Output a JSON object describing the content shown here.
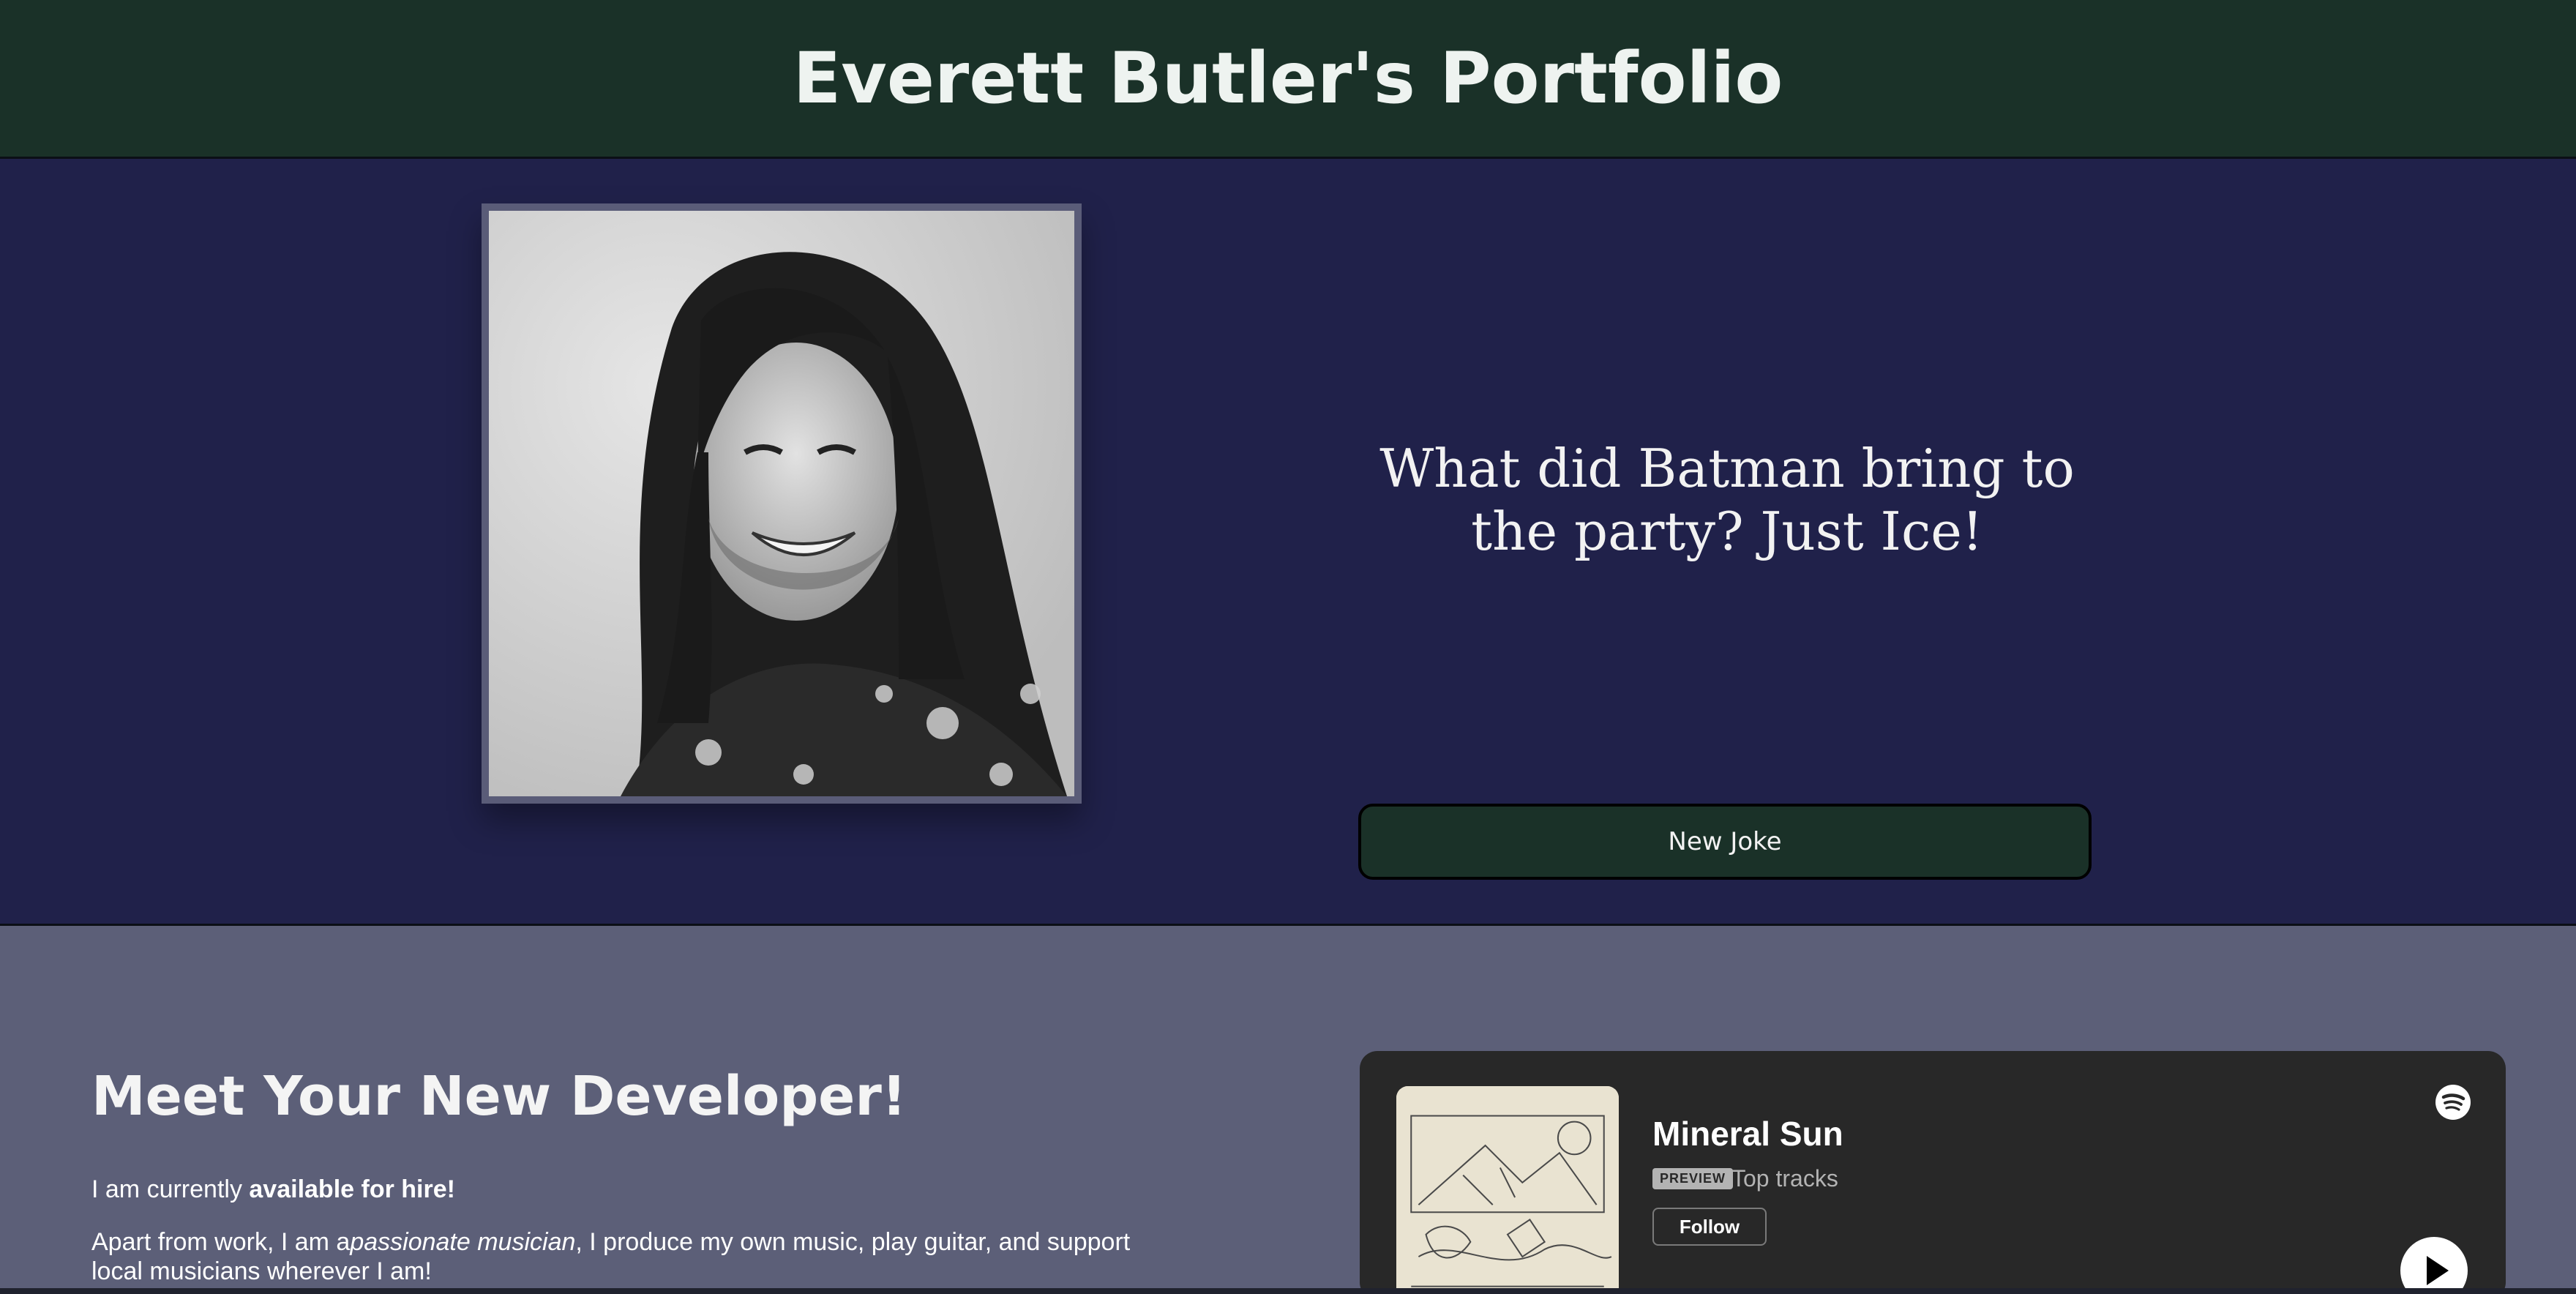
{
  "header": {
    "title": "Everett Butler's Portfolio"
  },
  "hero": {
    "photo_alt": "Everett Butler headshot",
    "joke": "What did Batman bring to the party? Just Ice!",
    "new_joke_label": "New Joke"
  },
  "about": {
    "heading": "Meet Your New Developer!",
    "p1_prefix": "I am currently ",
    "p1_bold": "available for hire!",
    "p2_prefix": "Apart from work, I am a",
    "p2_italic": "passionate musician",
    "p2_suffix": ", I produce my own music, play guitar, and support local musicians wherever I am!"
  },
  "spotify": {
    "artist": "Mineral Sun",
    "badge": "PREVIEW",
    "subtitle": "Top tracks",
    "follow_label": "Follow",
    "logo_icon": "spotify-icon",
    "play_icon": "play-icon"
  },
  "colors": {
    "header_bg": "#1a3128",
    "hero_bg": "#20214a",
    "about_bg": "#5c5f78",
    "spotify_bg": "#282828"
  }
}
